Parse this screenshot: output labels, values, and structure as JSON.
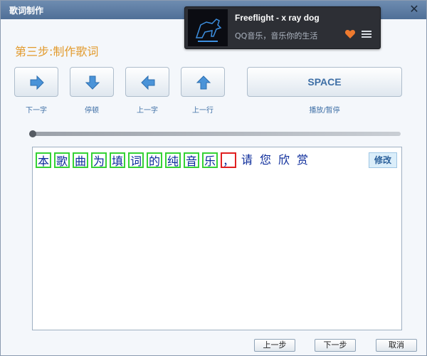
{
  "window": {
    "title": "歌词制作",
    "close_icon": "close-icon"
  },
  "player": {
    "song": "Freeflight - x ray dog",
    "subtitle": "QQ音乐，音乐你的生活",
    "heart_icon": "heart-icon",
    "menu_icon": "menu-icon"
  },
  "step_title": "第三步:制作歌词",
  "controls": [
    {
      "label": "下一字",
      "icon": "arrow-right-icon"
    },
    {
      "label": "停顿",
      "icon": "arrow-down-icon"
    },
    {
      "label": "上一字",
      "icon": "arrow-left-icon"
    },
    {
      "label": "上一行",
      "icon": "arrow-up-icon"
    }
  ],
  "space": {
    "label": "SPACE",
    "caption": "播放/暂停"
  },
  "progress": {
    "value": 0.0
  },
  "lyrics": {
    "chars": [
      "本",
      "歌",
      "曲",
      "为",
      "填",
      "词",
      "的",
      "纯",
      "音",
      "乐",
      "，",
      "请",
      "您",
      "欣",
      "赏"
    ],
    "done_count": 10,
    "current_index": 10,
    "edit_label": "修改"
  },
  "footer": {
    "prev_label": "上一步",
    "next_label": "下一步",
    "cancel_label": "取消"
  }
}
